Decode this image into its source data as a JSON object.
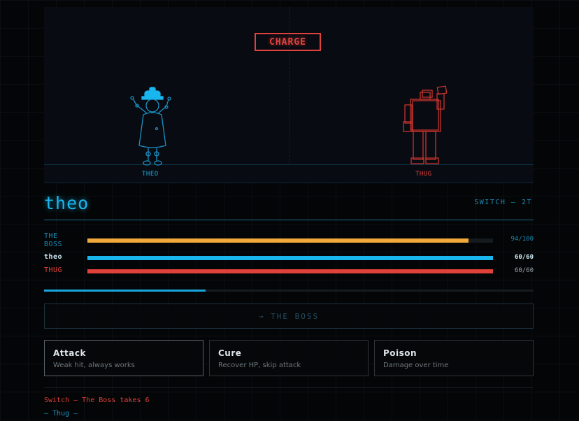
{
  "arena": {
    "banner": "CHARGE",
    "player_label": "THEO",
    "enemy_label": "THUG"
  },
  "hero": {
    "name": "theo",
    "move_tag": "SWITCH — 2T"
  },
  "hp_bars": [
    {
      "label": "THE\nBOSS",
      "value": "94/100",
      "fraction": 0.94,
      "color": "#f2a93b",
      "label_color": "#1d8cb8"
    },
    {
      "label": "theo",
      "value": "60/60",
      "fraction": 1.0,
      "color": "#19b6ee",
      "label_color": "#cfe8f5"
    },
    {
      "label": "THUG",
      "value": "60/60",
      "fraction": 1.0,
      "color": "#e0413a",
      "label_color": "#e0413a"
    }
  ],
  "turn_progress": 0.33,
  "target_button": "→ THE BOSS",
  "actions": [
    {
      "title": "Attack",
      "desc": "Weak hit, always works"
    },
    {
      "title": "Cure",
      "desc": "Recover HP, skip attack"
    },
    {
      "title": "Poison",
      "desc": "Damage over time"
    }
  ],
  "log": [
    {
      "text": "Switch — The Boss takes 6",
      "color": "#e0413a"
    },
    {
      "text": "— Thug —",
      "color": "#1d8cb8"
    }
  ],
  "colors": {
    "accent": "#19b6ee",
    "enemy": "#e0413a",
    "boss": "#f2a93b"
  }
}
